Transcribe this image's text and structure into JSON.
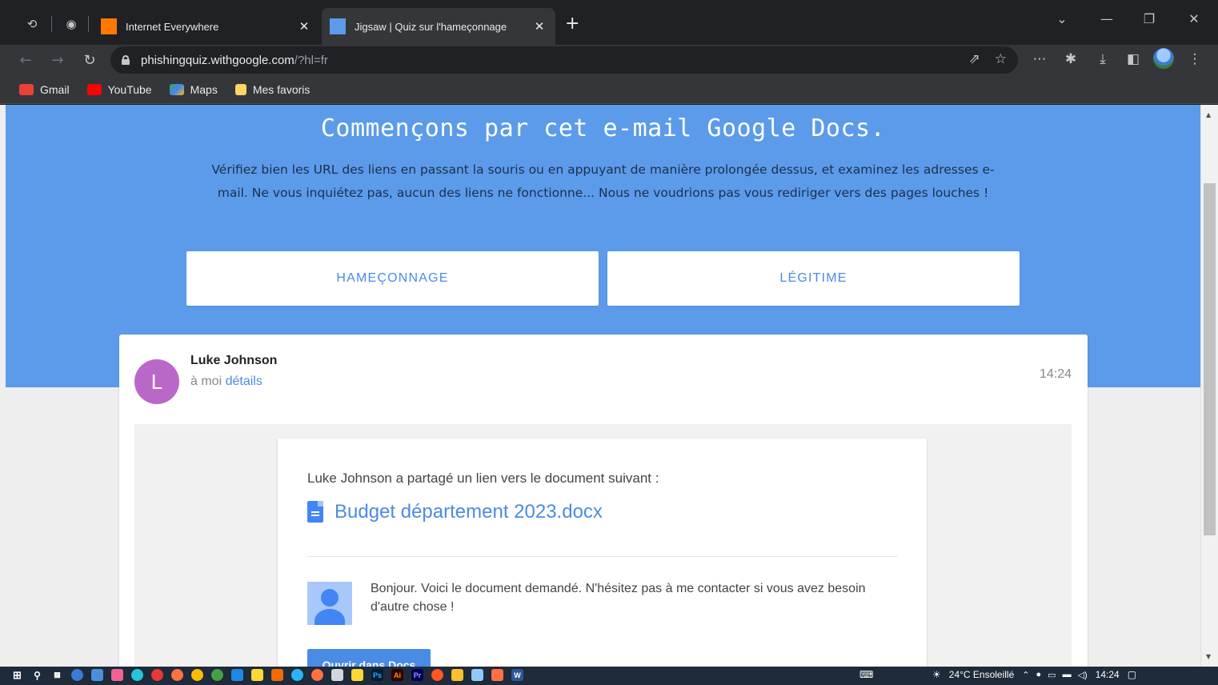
{
  "browser": {
    "tabs": [
      {
        "title": "Internet Everywhere",
        "favicon_color": "#ff7900",
        "active": false
      },
      {
        "title": "Jigsaw | Quiz sur l'hameçonnage",
        "favicon_color": "#5b9bea",
        "active": true
      }
    ],
    "url_host": "phishingquiz.withgoogle.com",
    "url_path": "/?hl=fr",
    "bookmarks": [
      {
        "label": "Gmail",
        "color": "#ea4335"
      },
      {
        "label": "YouTube",
        "color": "#ff0000"
      },
      {
        "label": "Maps",
        "color": "#34a853"
      },
      {
        "label": "Mes favoris",
        "color": "#fdd663"
      }
    ]
  },
  "quiz": {
    "heading": "Commençons par cet e-mail Google Docs.",
    "intro": "Vérifiez bien les URL des liens en passant la souris ou en appuyant de manière prolongée dessus, et examinez les adresses e-mail. Ne vous inquiétez pas, aucun des liens ne fonctionne... Nous ne voudrions pas vous rediriger vers des pages louches !",
    "choice_phishing": "HAMEÇONNAGE",
    "choice_legit": "LÉGITIME",
    "accent_color": "#5b9bea"
  },
  "email": {
    "avatar_letter": "L",
    "avatar_color": "#ba68c8",
    "sender": "Luke Johnson",
    "to_prefix": "à moi ",
    "details": "détails",
    "time": "14:24",
    "share_text": "Luke Johnson a partagé un lien vers le document suivant :",
    "doc_name": "Budget département 2023.docx",
    "message": "Bonjour. Voici le document demandé. N'hésitez pas à me contacter si vous avez besoin d'autre chose !",
    "open_button": "Ouvrir dans Docs"
  },
  "taskbar": {
    "weather": "24°C  Ensoleillé",
    "clock": "14:24"
  }
}
